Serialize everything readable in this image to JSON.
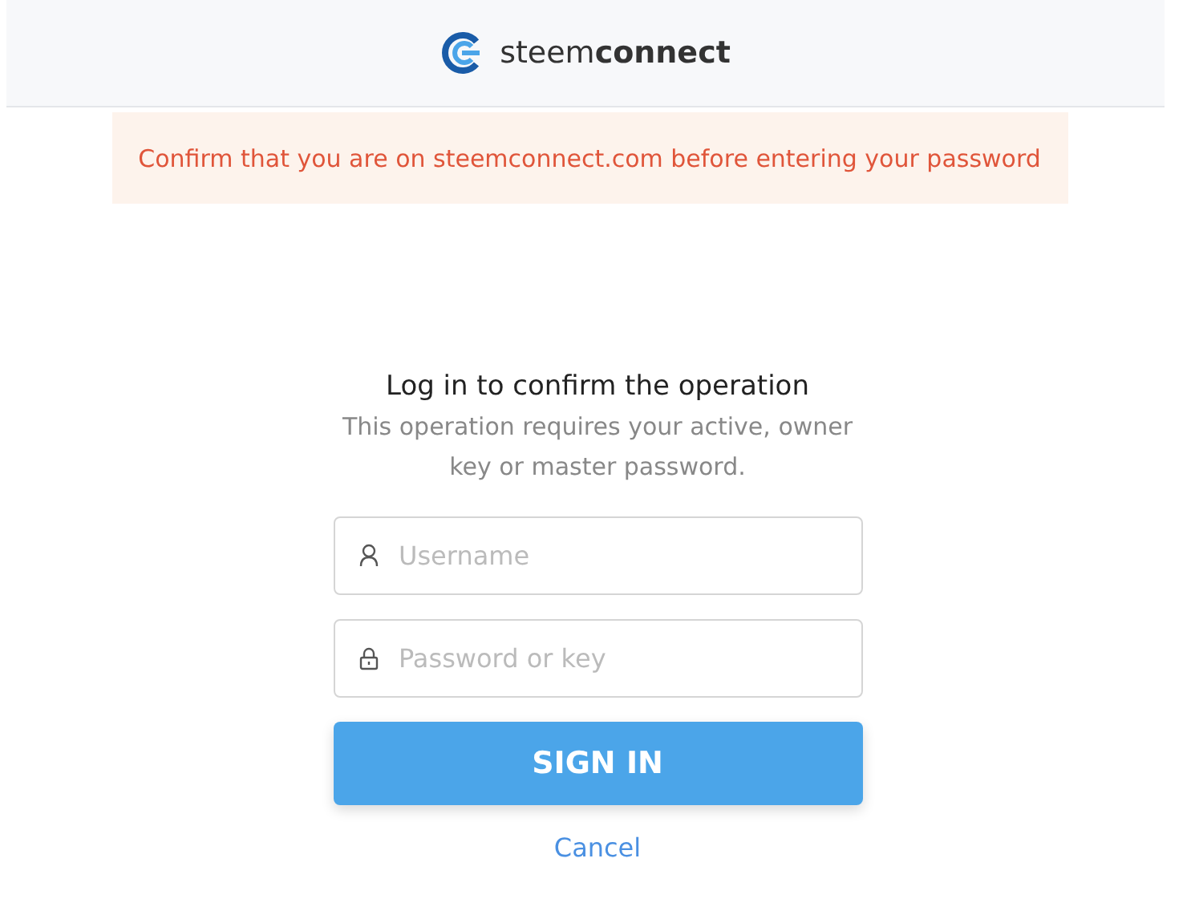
{
  "header": {
    "logo_text": "steem**connect**"
  },
  "alert": {
    "text": "Confirm that you are on steemconnect.com before entering your password"
  },
  "login": {
    "title": "Log in to confirm the operation",
    "subtitle": "This operation requires your active, owner key or master password.",
    "fields": [
      {
        "kind": "user",
        "placeholder": "Username"
      },
      {
        "kind": "lock",
        "placeholder": "Password or key"
      }
    ],
    "submit": "SIGN IN",
    "cancel": "Cancel"
  }
}
